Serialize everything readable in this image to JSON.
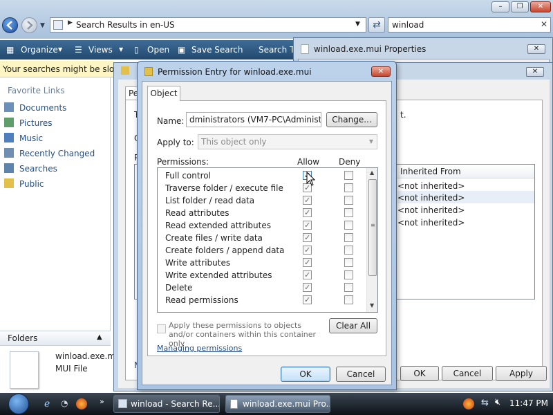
{
  "explorer": {
    "address": "Search Results in en-US",
    "search_value": "winload",
    "toolbar": {
      "organize": "Organize",
      "views": "Views",
      "open": "Open",
      "save_search": "Save Search",
      "search_tools": "Search To"
    },
    "infobar": "Your searches might be slow b",
    "nav": {
      "title": "Favorite Links",
      "items": [
        "Documents",
        "Pictures",
        "Music",
        "Recently Changed",
        "Searches",
        "Public"
      ]
    },
    "folders": "Folders",
    "details": {
      "name": "winload.exe.mu",
      "type": "MUI File"
    }
  },
  "props_window": {
    "title": "winload.exe.mui Properties",
    "buttons": {
      "ok": "OK",
      "cancel": "Cancel",
      "apply": "Apply"
    }
  },
  "adv_window": {
    "tab_fragment": "Pe",
    "frag_t": "T",
    "frag_o": "O",
    "frag_p": "P",
    "frag_m": "M",
    "frag_t_end": "t.",
    "inherited_header": "Inherited From",
    "inherited_values": [
      "<not inherited>",
      "<not inherited>",
      "<not inherited>",
      "<not inherited>"
    ]
  },
  "perm_dialog": {
    "title": "Permission Entry for winload.exe.mui",
    "tab": "Object",
    "name_label": "Name:",
    "name_value": "dministrators (VM7-PC\\Administrators)",
    "change_button": "Change...",
    "apply_to_label": "Apply to:",
    "apply_to_value": "This object only",
    "permissions_label": "Permissions:",
    "allow_header": "Allow",
    "deny_header": "Deny",
    "permissions": [
      {
        "name": "Full control",
        "allow": true,
        "deny": false
      },
      {
        "name": "Traverse folder / execute file",
        "allow": true,
        "deny": false
      },
      {
        "name": "List folder / read data",
        "allow": true,
        "deny": false
      },
      {
        "name": "Read attributes",
        "allow": true,
        "deny": false
      },
      {
        "name": "Read extended attributes",
        "allow": true,
        "deny": false
      },
      {
        "name": "Create files / write data",
        "allow": true,
        "deny": false
      },
      {
        "name": "Create folders / append data",
        "allow": true,
        "deny": false
      },
      {
        "name": "Write attributes",
        "allow": true,
        "deny": false
      },
      {
        "name": "Write extended attributes",
        "allow": true,
        "deny": false
      },
      {
        "name": "Delete",
        "allow": true,
        "deny": false
      },
      {
        "name": "Read permissions",
        "allow": true,
        "deny": false
      }
    ],
    "apply_children_label": "Apply these permissions to objects and/or containers within this container only",
    "clear_all": "Clear All",
    "managing_link": "Managing permissions",
    "ok": "OK",
    "cancel": "Cancel"
  },
  "taskbar": {
    "tasks": [
      "winload - Search Re...",
      "winload.exe.mui Pro..."
    ],
    "clock": "11:47 PM"
  },
  "colors": {
    "link": "#1f4f8a",
    "toolbar": "#2a5279",
    "taskbar": "#1a2129"
  }
}
